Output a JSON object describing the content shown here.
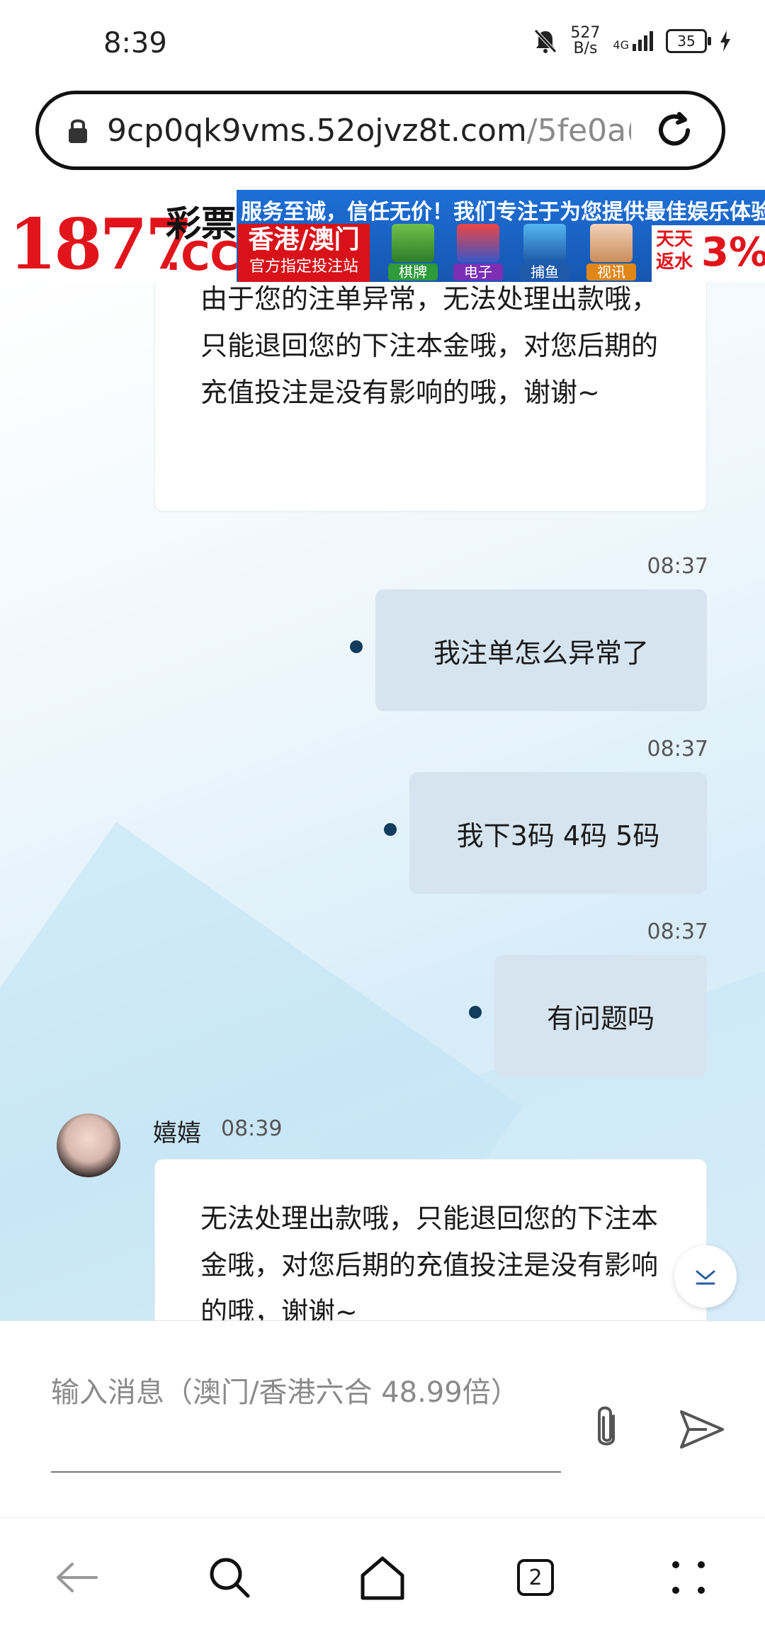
{
  "status_bar": {
    "time": "8:39",
    "net_speed_value": "527",
    "net_speed_unit": "B/s",
    "network": "4G",
    "battery": "35"
  },
  "browser": {
    "url_host": "9cp0qk9vms.52ojvz8t.com",
    "url_path": "/5fe0a("
  },
  "banner": {
    "logo_number": "1877",
    "logo_caipiao": "彩票",
    "logo_cc": ".CC",
    "slogan": "服务至诚，信任无价！我们专注于为您提供最佳娱乐体验！",
    "region": "香港/澳门",
    "region_sub": "官方指定投注站",
    "games": [
      "棋牌",
      "电子",
      "捕鱼",
      "视讯"
    ],
    "rebate_text": "天天\n返水",
    "rebate_pct": "3%"
  },
  "chat": {
    "messages": [
      {
        "direction": "in",
        "text": "由于您的注单异常，无法处理出款哦，只能退回您的下注本金哦，对您后期的充值投注是没有影响的哦，谢谢~"
      },
      {
        "direction": "out",
        "time": "08:37",
        "text": "我注单怎么异常了"
      },
      {
        "direction": "out",
        "time": "08:37",
        "text": "我下3码 4码 5码"
      },
      {
        "direction": "out",
        "time": "08:37",
        "text": "有问题吗"
      },
      {
        "direction": "in",
        "sender": "嬉嬉",
        "time": "08:39",
        "text": "无法处理出款哦，只能退回您的下注本金哦，对您后期的充值投注是没有影响的哦，谢谢~"
      }
    ]
  },
  "composer": {
    "placeholder": "输入消息（澳门/香港六合 48.99倍）"
  },
  "nav": {
    "tab_count": "2"
  }
}
